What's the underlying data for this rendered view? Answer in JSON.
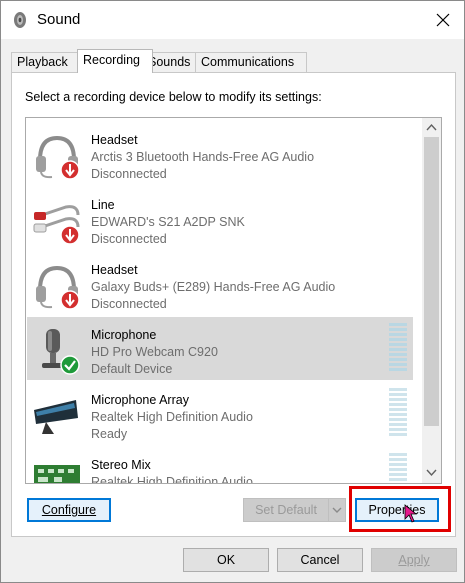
{
  "window": {
    "title": "Sound",
    "icon": "speaker-icon"
  },
  "tabs": [
    {
      "label": "Playback"
    },
    {
      "label": "Recording",
      "active": true
    },
    {
      "label": "Sounds"
    },
    {
      "label": "Communications"
    }
  ],
  "instruction": "Select a recording device below to modify its settings:",
  "devices": [
    {
      "name": "Headset",
      "desc": "Arctis 3 Bluetooth Hands-Free AG Audio",
      "status": "Disconnected",
      "icon": "headset-icon"
    },
    {
      "name": "Line",
      "desc": "EDWARD's S21 A2DP SNK",
      "status": "Disconnected",
      "icon": "line-in-icon"
    },
    {
      "name": "Headset",
      "desc": "Galaxy Buds+ (E289) Hands-Free AG Audio",
      "status": "Disconnected",
      "icon": "headset-icon"
    },
    {
      "name": "Microphone",
      "desc": "HD Pro Webcam C920",
      "status": "Default Device",
      "icon": "webcam-microphone-icon"
    },
    {
      "name": "Microphone Array",
      "desc": "Realtek High Definition Audio",
      "status": "Ready",
      "icon": "microphone-array-icon"
    },
    {
      "name": "Stereo Mix",
      "desc": "Realtek High Definition Audio",
      "status": "",
      "icon": "circuit-board-icon"
    }
  ],
  "buttons": {
    "configure": "Configure",
    "set_default": "Set Default",
    "properties": "Properties",
    "ok": "OK",
    "cancel": "Cancel",
    "apply": "Apply"
  },
  "colors": {
    "selected_row": "#d9d9d9",
    "highlight": "#e00000",
    "disconnected_badge": "#d32f2f",
    "default_badge": "#1f9a3a"
  }
}
